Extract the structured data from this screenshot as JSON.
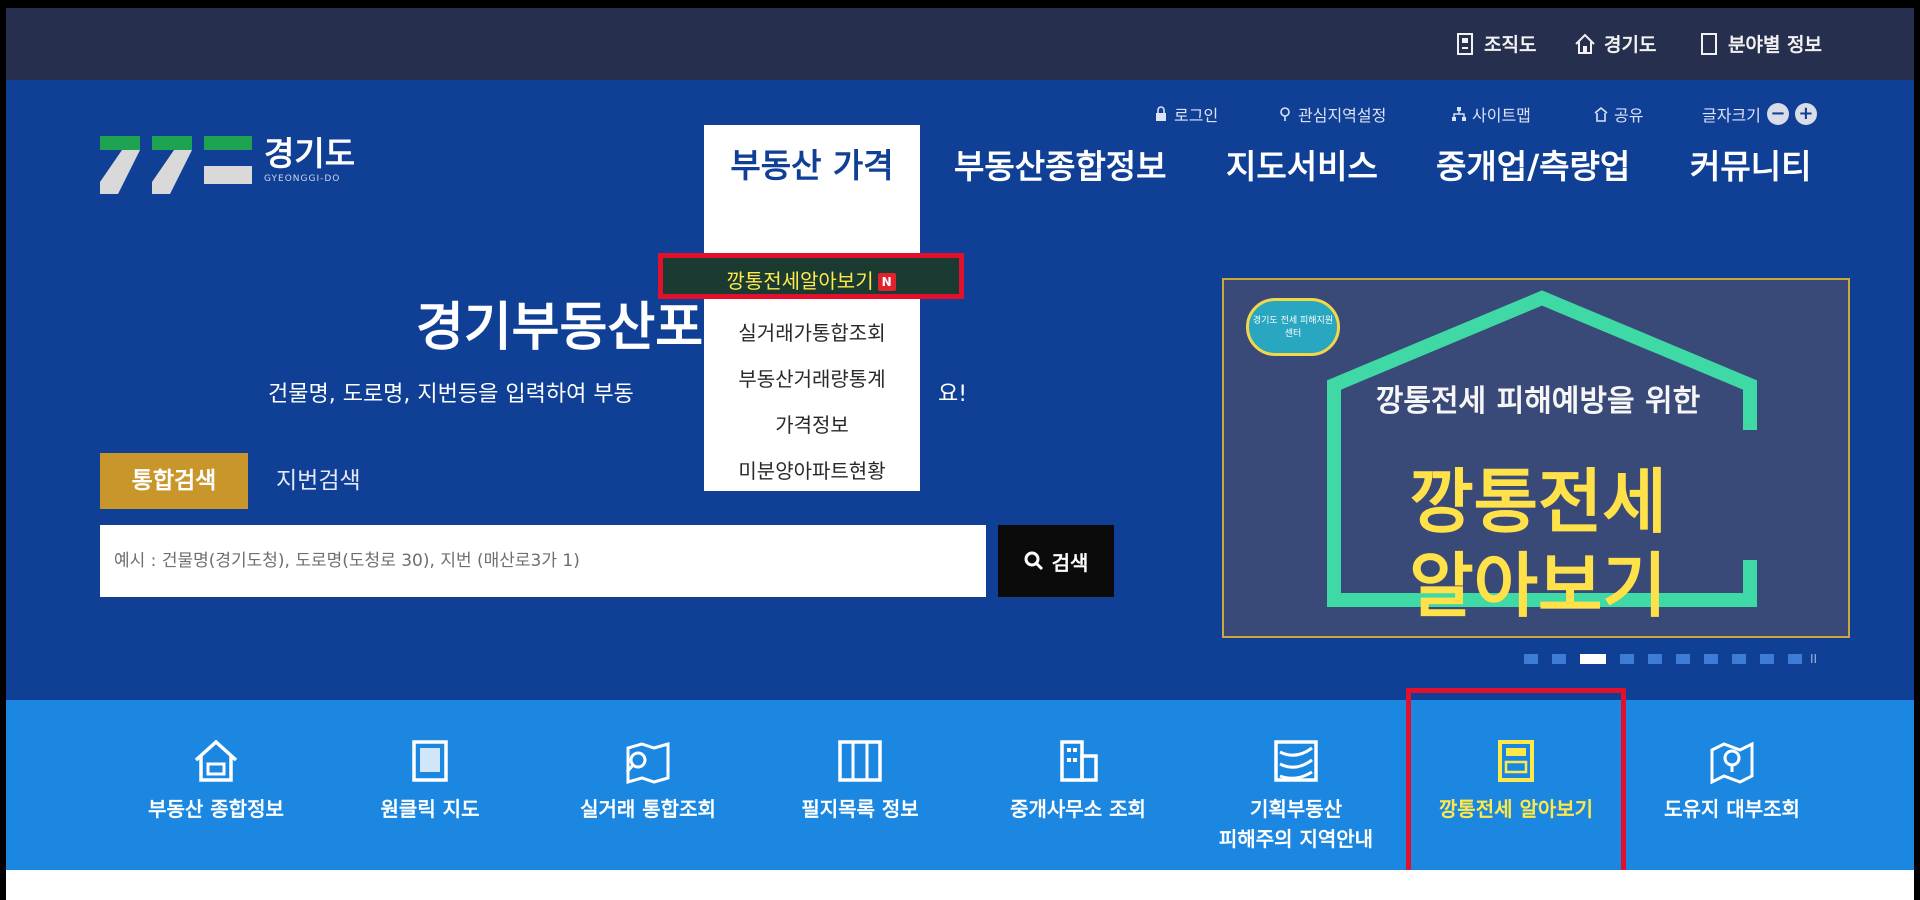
{
  "top_utility": {
    "items": [
      {
        "label": "조직도",
        "icon": "org-chart-icon"
      },
      {
        "label": "경기도",
        "icon": "home-icon"
      },
      {
        "label": "분야별 정보",
        "icon": "document-icon"
      }
    ]
  },
  "logo": {
    "title": "경기도",
    "sub": "GYEONGGI-DO"
  },
  "member_menu": {
    "login": "로그인",
    "interest": "관심지역설정",
    "sitemap": "사이트맵",
    "share": "공유",
    "font_size": "글자크기",
    "zoom_out": "−",
    "zoom_in": "+"
  },
  "gnb": {
    "items": [
      "부동산 가격",
      "부동산종합정보",
      "지도서비스",
      "중개업/측량업",
      "커뮤니티"
    ],
    "dropdown": {
      "items": [
        "깡통전세알아보기",
        "실거래가통합조회",
        "부동산거래량통계",
        "가격정보",
        "미분양아파트현황"
      ],
      "new_badge": "N"
    }
  },
  "hero": {
    "title": "경기부동산포",
    "desc": "건물명, 도로명, 지번등을 입력하여 부동",
    "desc_tail": "요!"
  },
  "search": {
    "tab_integrated": "통합검색",
    "tab_lot": "지번검색",
    "placeholder": "예시 : 건물명(경기도청), 도로명(도청로 30), 지번 (매산로3가 1)",
    "button": "검색"
  },
  "banner": {
    "badge": "경기도 전세 피해지원센터",
    "sub": "깡통전세 피해예방을 위한",
    "big1": "깡통전세",
    "big2": "알아보기",
    "dots": 11,
    "active_dot": 3,
    "pause": "II"
  },
  "quick_menu": [
    {
      "label": "부동산 종합정보",
      "icon": "house-icon"
    },
    {
      "label": "원클릭 지도",
      "icon": "map-phone-icon"
    },
    {
      "label": "실거래 통합조회",
      "icon": "map-search-icon"
    },
    {
      "label": "필지목록 정보",
      "icon": "grid-list-icon"
    },
    {
      "label": "중개사무소 조회",
      "icon": "building-icon"
    },
    {
      "label": "기획부동산",
      "label2": "피해주의 지역안내",
      "icon": "warning-map-icon"
    },
    {
      "label": "깡통전세 알아보기",
      "icon": "calculator-icon"
    },
    {
      "label": "도유지 대부조회",
      "icon": "location-map-icon"
    }
  ],
  "colors": {
    "hero_bg": "#103f96",
    "topbar_bg": "#262f4d",
    "quick_bg": "#1b87e0",
    "accent_gold": "#c8962b",
    "highlight": "#e1112e",
    "yellow": "#ffe94a"
  }
}
